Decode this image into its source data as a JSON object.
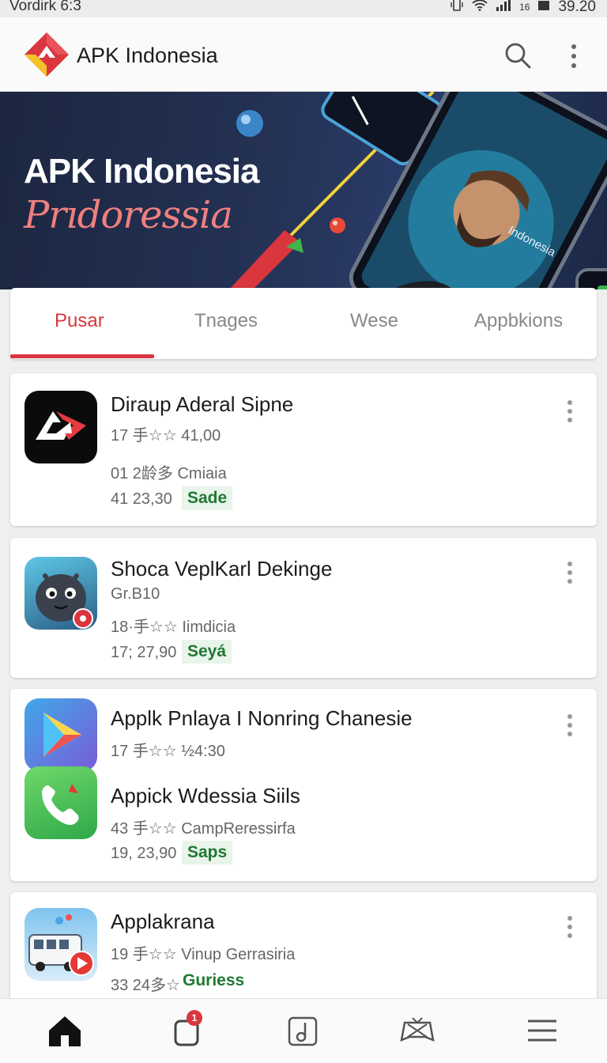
{
  "status_bar": {
    "carrier": "Vordirk 6:3",
    "clock": "39.20",
    "network_label": "16"
  },
  "app_bar": {
    "title": "APK Indonesia",
    "logo_icon": "apk-diamond-logo",
    "search_icon": "search-icon",
    "more_icon": "more-vertical-icon"
  },
  "banner": {
    "title": "APK Indonesia",
    "subtitle": "Prıdoressia",
    "phone_screen_label": "Indonesia"
  },
  "tabs": [
    {
      "label": "Pusar",
      "active": true
    },
    {
      "label": "Tnages",
      "active": false
    },
    {
      "label": "Wese",
      "active": false
    },
    {
      "label": "Appbkions",
      "active": false
    }
  ],
  "cards": [
    {
      "apps": [
        {
          "name": "Diraup Aderal Sipne",
          "line1": "17 手☆☆ 41,00",
          "line2": "01 2龄多 Cmiaia",
          "line3": "41 23,30",
          "badge": "Sade",
          "icon": "apk-red-logo-icon"
        }
      ]
    },
    {
      "apps": [
        {
          "name": "Shoca VeplKarl Dekinge",
          "line1": "Gr.B10",
          "line2": "18·手☆☆ Iimdicia",
          "line3": "17; 27,90",
          "badge": "Seyá",
          "icon": "cartoon-character-icon"
        }
      ]
    },
    {
      "apps": [
        {
          "name": "Applk Pnlaya I Nonring Chanesie",
          "line1": "17 手☆☆ ½4:30",
          "icon": "play-triangle-icon"
        },
        {
          "name": "Appick Wdessia Siils",
          "line1": "43 手☆☆ CampReressirfa",
          "line3": "19, 23,90",
          "badge": "Saps",
          "icon": "phone-call-icon"
        }
      ]
    },
    {
      "apps": [
        {
          "name": "Applakrana",
          "line1": "19 手☆☆ Vinup Gerrasiria",
          "line3": "33 24多☆",
          "badge": "Guriess",
          "icon": "bus-video-icon"
        }
      ]
    }
  ],
  "bottom_nav": [
    {
      "icon": "home-icon",
      "active": true
    },
    {
      "icon": "app-box-icon",
      "badge": "1"
    },
    {
      "icon": "music-note-icon"
    },
    {
      "icon": "game-controller-icon"
    },
    {
      "icon": "menu-icon"
    }
  ],
  "colors": {
    "accent": "#d9363e",
    "badge_green": "#1e7a32",
    "banner_bg": "#1c2640",
    "subtitle_pink": "#f07f7f"
  }
}
